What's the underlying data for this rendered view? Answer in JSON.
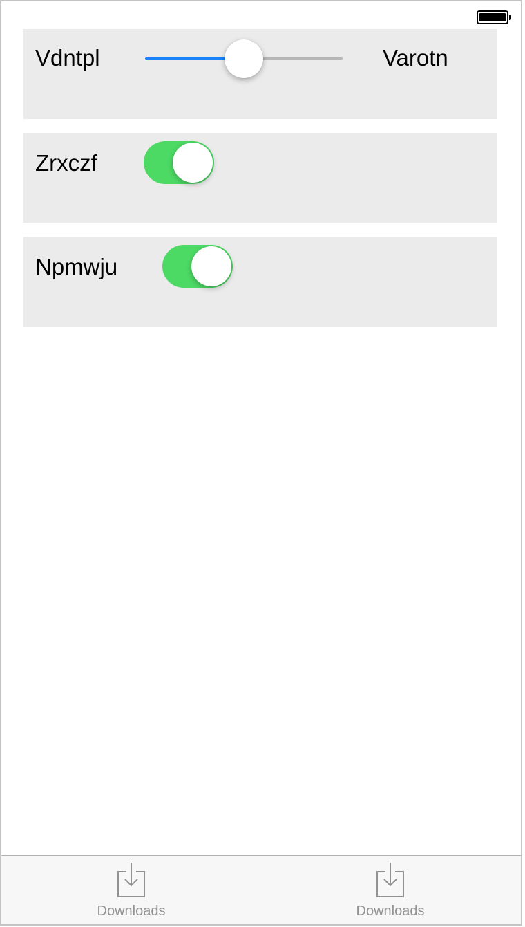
{
  "status_bar": {
    "battery_icon": "battery-full-icon"
  },
  "rows": [
    {
      "type": "slider",
      "label": "Vdntpl",
      "value_label": "Varotn",
      "value": 0.5
    },
    {
      "type": "switch",
      "label": "Zrxczf",
      "on": true
    },
    {
      "type": "switch",
      "label": "Npmwju",
      "on": true
    }
  ],
  "colors": {
    "switch_on": "#4cd964",
    "slider_min_track": "#1a82fb",
    "row_background": "#ebebeb"
  },
  "tabbar": {
    "items": [
      {
        "label": "Downloads",
        "icon": "download-icon"
      },
      {
        "label": "Downloads",
        "icon": "download-icon"
      }
    ]
  }
}
